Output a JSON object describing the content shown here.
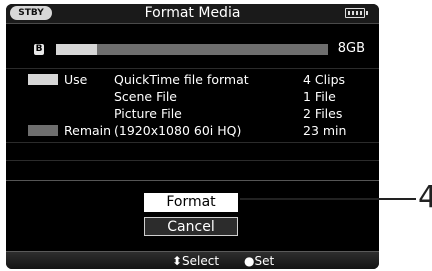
{
  "header": {
    "status_badge": "STBY",
    "title": "Format Media",
    "battery_icon": "battery-icon"
  },
  "media": {
    "slot": "B",
    "capacity": "8GB",
    "used_fraction": 0.15
  },
  "rows": {
    "use": {
      "label": "Use",
      "desc": "QuickTime file format",
      "value": "4 Clips"
    },
    "scene": {
      "desc": "Scene File",
      "value": "1 File"
    },
    "picture": {
      "desc": "Picture File",
      "value": "2 Files"
    },
    "remain": {
      "label": "Remain",
      "desc": "(1920x1080 60i HQ)",
      "value": "23 min"
    }
  },
  "dialog": {
    "format_label": "Format",
    "cancel_label": "Cancel"
  },
  "footer": {
    "select_hint": "⬍Select",
    "set_hint": "●Set"
  },
  "callout": {
    "number": "4"
  },
  "colors": {
    "used": "#d6d6d6",
    "remaining": "#6e6e6e",
    "highlight": "#ffffff"
  }
}
